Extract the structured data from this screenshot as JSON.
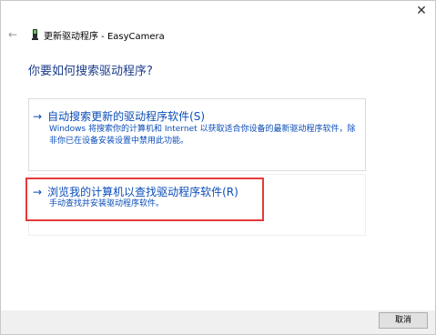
{
  "window": {
    "title": "更新驱动程序 - EasyCamera"
  },
  "icons": {
    "back": "back-arrow-icon",
    "device": "device-icon",
    "close": "close-icon"
  },
  "heading": "你要如何搜索驱动程序?",
  "options": [
    {
      "title": "自动搜索更新的驱动程序软件(S)",
      "description": "Windows 将搜索你的计算机和 Internet 以获取适合你设备的最新驱动程序软件，除非你已在设备安装设置中禁用此功能。"
    },
    {
      "title": "浏览我的计算机以查找驱动程序软件(R)",
      "description": "手动查找并安装驱动程序软件。"
    }
  ],
  "footer": {
    "cancel_label": "取消"
  },
  "colors": {
    "link": "#0a4db8",
    "heading": "#1c3c8a",
    "highlight": "#e43a3a"
  }
}
